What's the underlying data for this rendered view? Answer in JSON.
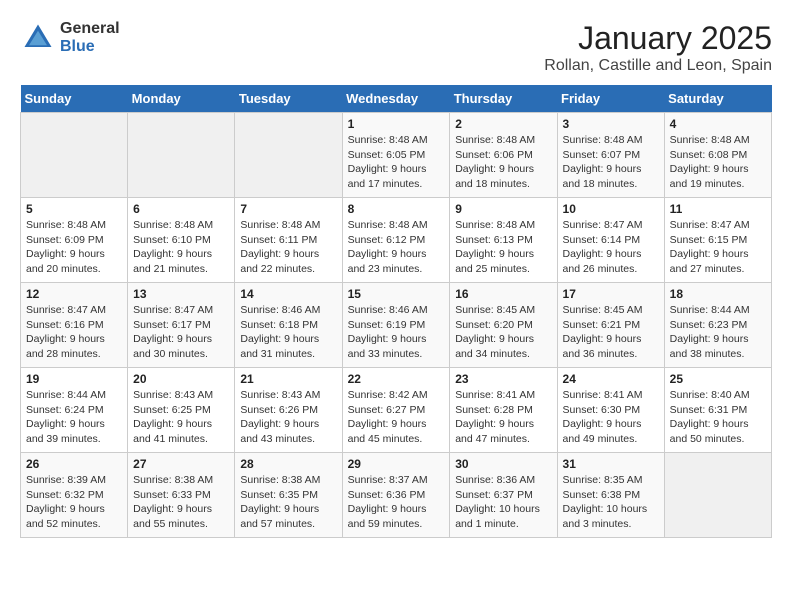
{
  "header": {
    "logo_general": "General",
    "logo_blue": "Blue",
    "title": "January 2025",
    "subtitle": "Rollan, Castille and Leon, Spain"
  },
  "days_of_week": [
    "Sunday",
    "Monday",
    "Tuesday",
    "Wednesday",
    "Thursday",
    "Friday",
    "Saturday"
  ],
  "weeks": [
    [
      {
        "day": "",
        "info": ""
      },
      {
        "day": "",
        "info": ""
      },
      {
        "day": "",
        "info": ""
      },
      {
        "day": "1",
        "info": "Sunrise: 8:48 AM\nSunset: 6:05 PM\nDaylight: 9 hours and 17 minutes."
      },
      {
        "day": "2",
        "info": "Sunrise: 8:48 AM\nSunset: 6:06 PM\nDaylight: 9 hours and 18 minutes."
      },
      {
        "day": "3",
        "info": "Sunrise: 8:48 AM\nSunset: 6:07 PM\nDaylight: 9 hours and 18 minutes."
      },
      {
        "day": "4",
        "info": "Sunrise: 8:48 AM\nSunset: 6:08 PM\nDaylight: 9 hours and 19 minutes."
      }
    ],
    [
      {
        "day": "5",
        "info": "Sunrise: 8:48 AM\nSunset: 6:09 PM\nDaylight: 9 hours and 20 minutes."
      },
      {
        "day": "6",
        "info": "Sunrise: 8:48 AM\nSunset: 6:10 PM\nDaylight: 9 hours and 21 minutes."
      },
      {
        "day": "7",
        "info": "Sunrise: 8:48 AM\nSunset: 6:11 PM\nDaylight: 9 hours and 22 minutes."
      },
      {
        "day": "8",
        "info": "Sunrise: 8:48 AM\nSunset: 6:12 PM\nDaylight: 9 hours and 23 minutes."
      },
      {
        "day": "9",
        "info": "Sunrise: 8:48 AM\nSunset: 6:13 PM\nDaylight: 9 hours and 25 minutes."
      },
      {
        "day": "10",
        "info": "Sunrise: 8:47 AM\nSunset: 6:14 PM\nDaylight: 9 hours and 26 minutes."
      },
      {
        "day": "11",
        "info": "Sunrise: 8:47 AM\nSunset: 6:15 PM\nDaylight: 9 hours and 27 minutes."
      }
    ],
    [
      {
        "day": "12",
        "info": "Sunrise: 8:47 AM\nSunset: 6:16 PM\nDaylight: 9 hours and 28 minutes."
      },
      {
        "day": "13",
        "info": "Sunrise: 8:47 AM\nSunset: 6:17 PM\nDaylight: 9 hours and 30 minutes."
      },
      {
        "day": "14",
        "info": "Sunrise: 8:46 AM\nSunset: 6:18 PM\nDaylight: 9 hours and 31 minutes."
      },
      {
        "day": "15",
        "info": "Sunrise: 8:46 AM\nSunset: 6:19 PM\nDaylight: 9 hours and 33 minutes."
      },
      {
        "day": "16",
        "info": "Sunrise: 8:45 AM\nSunset: 6:20 PM\nDaylight: 9 hours and 34 minutes."
      },
      {
        "day": "17",
        "info": "Sunrise: 8:45 AM\nSunset: 6:21 PM\nDaylight: 9 hours and 36 minutes."
      },
      {
        "day": "18",
        "info": "Sunrise: 8:44 AM\nSunset: 6:23 PM\nDaylight: 9 hours and 38 minutes."
      }
    ],
    [
      {
        "day": "19",
        "info": "Sunrise: 8:44 AM\nSunset: 6:24 PM\nDaylight: 9 hours and 39 minutes."
      },
      {
        "day": "20",
        "info": "Sunrise: 8:43 AM\nSunset: 6:25 PM\nDaylight: 9 hours and 41 minutes."
      },
      {
        "day": "21",
        "info": "Sunrise: 8:43 AM\nSunset: 6:26 PM\nDaylight: 9 hours and 43 minutes."
      },
      {
        "day": "22",
        "info": "Sunrise: 8:42 AM\nSunset: 6:27 PM\nDaylight: 9 hours and 45 minutes."
      },
      {
        "day": "23",
        "info": "Sunrise: 8:41 AM\nSunset: 6:28 PM\nDaylight: 9 hours and 47 minutes."
      },
      {
        "day": "24",
        "info": "Sunrise: 8:41 AM\nSunset: 6:30 PM\nDaylight: 9 hours and 49 minutes."
      },
      {
        "day": "25",
        "info": "Sunrise: 8:40 AM\nSunset: 6:31 PM\nDaylight: 9 hours and 50 minutes."
      }
    ],
    [
      {
        "day": "26",
        "info": "Sunrise: 8:39 AM\nSunset: 6:32 PM\nDaylight: 9 hours and 52 minutes."
      },
      {
        "day": "27",
        "info": "Sunrise: 8:38 AM\nSunset: 6:33 PM\nDaylight: 9 hours and 55 minutes."
      },
      {
        "day": "28",
        "info": "Sunrise: 8:38 AM\nSunset: 6:35 PM\nDaylight: 9 hours and 57 minutes."
      },
      {
        "day": "29",
        "info": "Sunrise: 8:37 AM\nSunset: 6:36 PM\nDaylight: 9 hours and 59 minutes."
      },
      {
        "day": "30",
        "info": "Sunrise: 8:36 AM\nSunset: 6:37 PM\nDaylight: 10 hours and 1 minute."
      },
      {
        "day": "31",
        "info": "Sunrise: 8:35 AM\nSunset: 6:38 PM\nDaylight: 10 hours and 3 minutes."
      },
      {
        "day": "",
        "info": ""
      }
    ]
  ]
}
